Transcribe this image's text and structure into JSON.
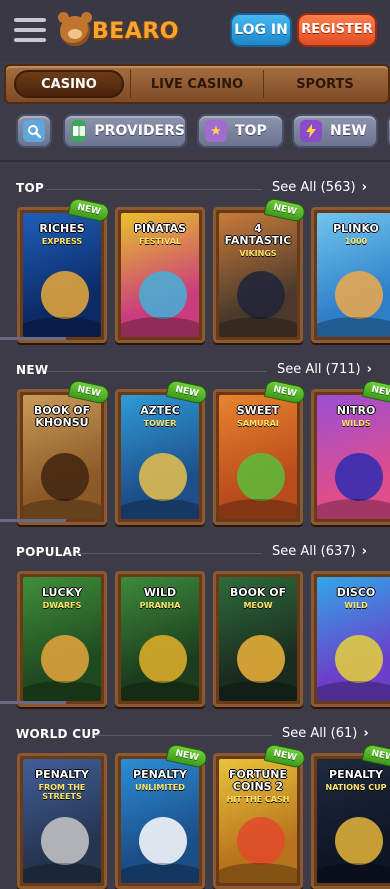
{
  "header": {
    "brand": "BEARO",
    "login_label": "LOG IN",
    "register_label": "REGISTER"
  },
  "tabs": [
    {
      "label": "CASINO",
      "active": true
    },
    {
      "label": "LIVE CASINO",
      "active": false
    },
    {
      "label": "SPORTS",
      "active": false
    }
  ],
  "filters": [
    {
      "icon": "search-icon"
    },
    {
      "icon": "book-icon",
      "label": "PROVIDERS"
    },
    {
      "icon": "star-icon",
      "label": "TOP"
    },
    {
      "icon": "bolt-icon",
      "label": "NEW"
    }
  ],
  "sections": [
    {
      "title": "TOP",
      "see_all": "See All (563)",
      "games": [
        {
          "title": "RICHES",
          "subtitle": "EXPRESS",
          "new": true,
          "colors": [
            "#1e5fb8",
            "#0c2a66",
            "#e9a93a"
          ]
        },
        {
          "title": "PIÑATAS",
          "subtitle": "FESTIVAL",
          "new": false,
          "colors": [
            "#e8c12c",
            "#c93d7c",
            "#43b0d8"
          ]
        },
        {
          "title": "4 FANTASTIC",
          "subtitle": "VIKINGS",
          "new": true,
          "colors": [
            "#c87a3a",
            "#4b3a2c",
            "#1f2538"
          ]
        },
        {
          "title": "PLINKO",
          "subtitle": "1000",
          "new": false,
          "colors": [
            "#6fc6ee",
            "#2f7fc8",
            "#f0a94a"
          ]
        }
      ]
    },
    {
      "title": "NEW",
      "see_all": "See All (711)",
      "games": [
        {
          "title": "BOOK OF KHONSU",
          "subtitle": "",
          "new": true,
          "colors": [
            "#c99a57",
            "#8c5a28",
            "#3f2410"
          ]
        },
        {
          "title": "AZTEC",
          "subtitle": "TOWER",
          "new": true,
          "colors": [
            "#2e9bd6",
            "#1e4f8a",
            "#e7c14a"
          ]
        },
        {
          "title": "SWEET",
          "subtitle": "SAMURAI",
          "new": true,
          "colors": [
            "#e9842e",
            "#b84c1c",
            "#5cbd3a"
          ]
        },
        {
          "title": "NITRO",
          "subtitle": "WILDS",
          "new": true,
          "colors": [
            "#9b4fd6",
            "#e04d8b",
            "#2b2bb0"
          ]
        }
      ]
    },
    {
      "title": "POPULAR",
      "see_all": "See All (637)",
      "games": [
        {
          "title": "LUCKY",
          "subtitle": "DWARFS",
          "new": false,
          "colors": [
            "#3f8f3a",
            "#1f4a20",
            "#e6a63c"
          ]
        },
        {
          "title": "WILD",
          "subtitle": "PIRANHA",
          "new": false,
          "colors": [
            "#3d8a3c",
            "#1c3d1d",
            "#e4b02a"
          ]
        },
        {
          "title": "BOOK OF",
          "subtitle": "MEOW",
          "new": false,
          "colors": [
            "#2e6b3a",
            "#1a2b1f",
            "#f0b43a"
          ]
        },
        {
          "title": "DISCO",
          "subtitle": "WILD",
          "new": false,
          "colors": [
            "#31a7e8",
            "#6b3fc9",
            "#e6d23a"
          ]
        }
      ]
    },
    {
      "title": "WORLD CUP",
      "see_all": "See All (61)",
      "games": [
        {
          "title": "PENALTY",
          "subtitle": "FROM THE STREETS",
          "new": false,
          "colors": [
            "#3f5f9a",
            "#26354f",
            "#c8c8c8"
          ]
        },
        {
          "title": "PENALTY",
          "subtitle": "UNLIMITED",
          "new": true,
          "colors": [
            "#2b8dd6",
            "#1b4d86",
            "#ffffff"
          ]
        },
        {
          "title": "FORTUNE COINS 2",
          "subtitle": "HIT THE CASH",
          "new": true,
          "colors": [
            "#e8c33c",
            "#b8741c",
            "#e24a2a"
          ]
        },
        {
          "title": "PENALTY",
          "subtitle": "NATIONS CUP",
          "new": true,
          "colors": [
            "#1f2a3f",
            "#0f1626",
            "#e5b63a"
          ]
        }
      ]
    }
  ]
}
